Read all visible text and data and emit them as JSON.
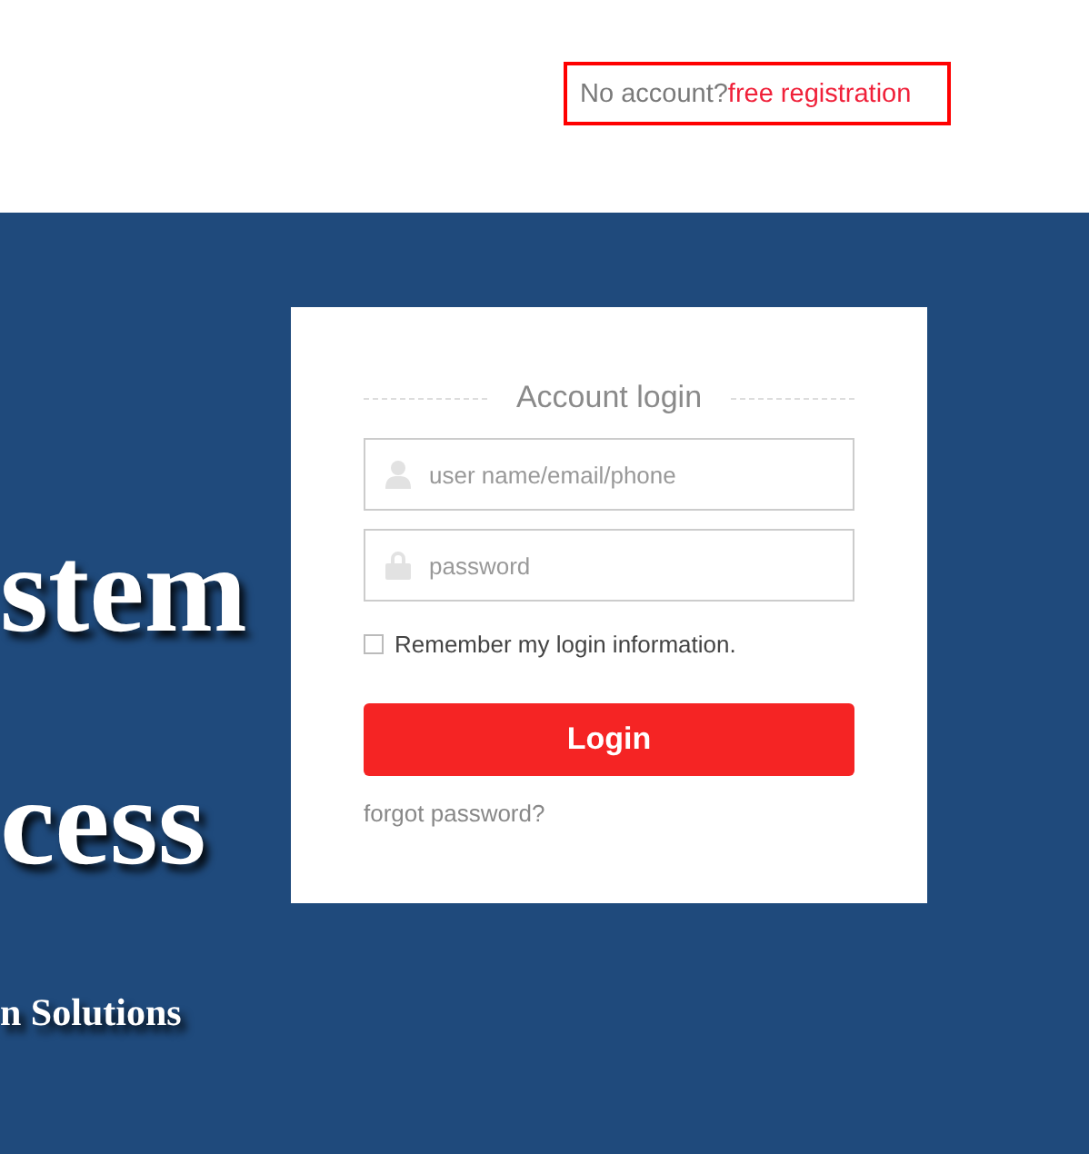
{
  "header": {
    "prompt": "No account?",
    "link": "free registration"
  },
  "hero": {
    "lines": [
      {
        "kind": "title",
        "text": "stem"
      },
      {
        "kind": "title",
        "text": "cess"
      },
      {
        "kind": "subtitle",
        "text": "n Solutions"
      }
    ]
  },
  "login": {
    "title": "Account login",
    "fields": [
      {
        "kind": "user",
        "placeholder": "user name/email/phone"
      },
      {
        "kind": "password",
        "placeholder": "password"
      }
    ],
    "remember": {
      "label": "Remember my login information.",
      "checked": false
    },
    "button": "Login",
    "forgot": "forgot password?"
  }
}
